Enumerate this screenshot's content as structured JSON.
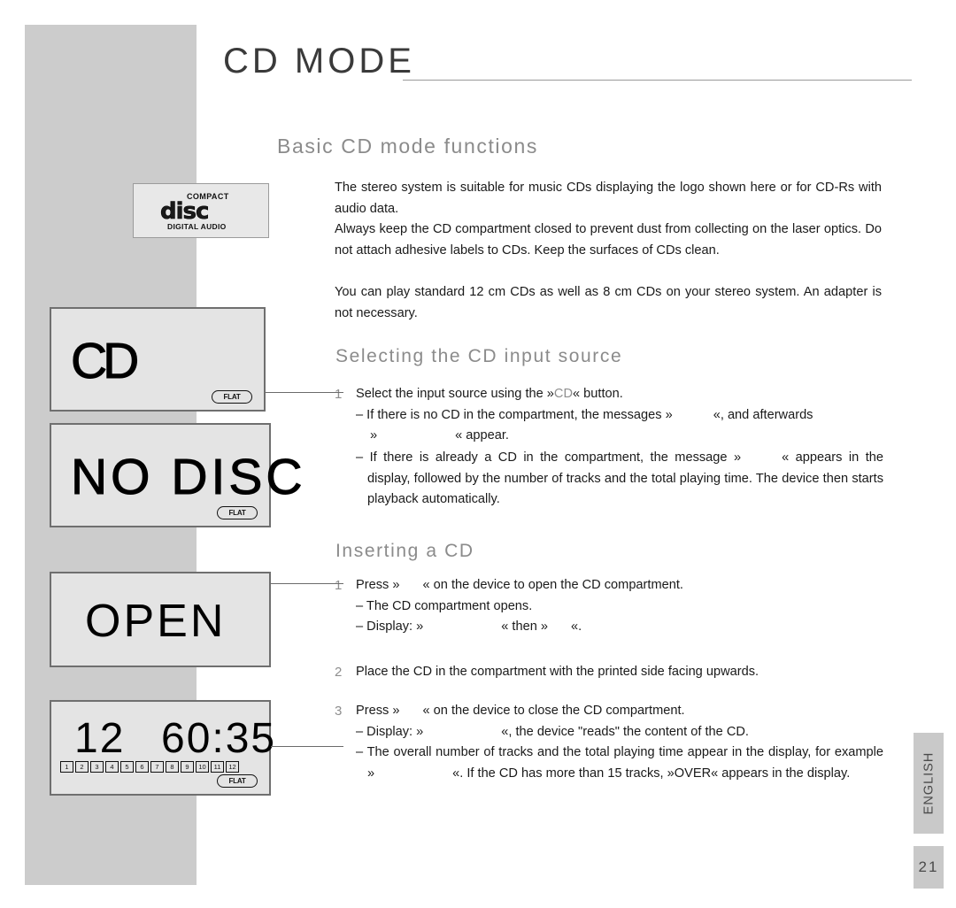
{
  "page": {
    "title": "CD MODE",
    "language_tab": "ENGLISH",
    "page_number": "21"
  },
  "sections": {
    "basic": {
      "heading": "Basic CD mode functions",
      "intro_p1": "The stereo system is suitable for music CDs displaying the logo shown here or for CD-Rs with audio data.",
      "intro_p2": "Always keep the CD compartment closed to prevent dust from collecting on the laser optics. Do not attach adhesive labels to CDs. Keep the surfaces of CDs clean.",
      "intro_p3": "You can play standard 12 cm CDs as well as 8 cm CDs on your stereo system. An adapter is not necessary."
    },
    "selecting": {
      "heading": "Selecting the CD input source",
      "step1_num": "1",
      "step1_a": "Select the input source using the »",
      "step1_button": "CD",
      "step1_b": "« button.",
      "step1_sub1_a": "– If there is no CD in the compartment, the messages »",
      "step1_sub1_b": "«, and afterwards",
      "step1_sub1_c": "»",
      "step1_sub1_d": "« appear.",
      "step1_sub2_a": "– If there is already a CD in the compartment, the message »",
      "step1_sub2_b": "« appears in the display, followed by the number of tracks and the total playing time. The device then starts playback automatically."
    },
    "inserting": {
      "heading": "Inserting a CD",
      "step1_num": "1",
      "step1_a": "Press »",
      "step1_b": "« on the device to open the CD compartment.",
      "step1_sub1": "– The CD compartment opens.",
      "step1_sub2_a": "– Display: »",
      "step1_sub2_b": "« then »",
      "step1_sub2_c": "«.",
      "step2_num": "2",
      "step2_text": "Place the CD in the compartment with the printed side facing upwards.",
      "step3_num": "3",
      "step3_a": "Press »",
      "step3_b": "« on the device to close the CD compartment.",
      "step3_sub1_a": "– Display: »",
      "step3_sub1_b": "«, the device \"reads\" the content of the CD.",
      "step3_sub2_a": "– The overall number of tracks and the total playing time appear in the display, for example »",
      "step3_sub2_b": "«. If the CD has more than 15 tracks, »OVER« appears in the display."
    }
  },
  "cd_logo": {
    "top_text": "COMPACT",
    "mid_text": "disc",
    "bottom_text": "DIGITAL AUDIO"
  },
  "displays": [
    {
      "name": "cd-display",
      "text": "CD",
      "flat_badge": "FLAT",
      "has_tracks": false
    },
    {
      "name": "no-disc-display",
      "text": "NO DISC",
      "flat_badge": "FLAT",
      "has_tracks": false
    },
    {
      "name": "open-display",
      "text": "OPEN",
      "flat_badge": null,
      "has_tracks": false
    },
    {
      "name": "track-time-display",
      "track_count": "12",
      "time": "60:35",
      "flat_badge": "FLAT",
      "has_tracks": true,
      "track_numbers": [
        "1",
        "2",
        "3",
        "4",
        "5",
        "6",
        "7",
        "8",
        "9",
        "10",
        "11",
        "12"
      ]
    }
  ]
}
